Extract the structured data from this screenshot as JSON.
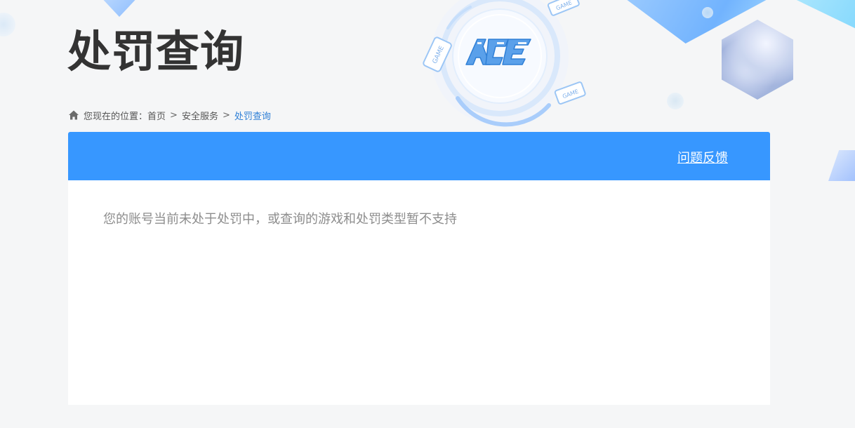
{
  "page": {
    "title": "处罚查询"
  },
  "breadcrumb": {
    "prefix": "您现在的位置：",
    "home": "首页",
    "separator": ">",
    "section": "安全服务",
    "current": "处罚查询"
  },
  "header": {
    "feedback_label": "问题反馈"
  },
  "content": {
    "message": "您的账号当前未处于处罚中，或查询的游戏和处罚类型暂不支持"
  },
  "emblem": {
    "logo_text": "ACE",
    "tag_text": "GAME"
  },
  "icons": {
    "home": "home-icon"
  },
  "colors": {
    "accent": "#3797ff",
    "breadcrumb_current": "#2e7fd6",
    "title": "#333333",
    "message": "#8d8d8d",
    "background": "#f5f6f7"
  }
}
